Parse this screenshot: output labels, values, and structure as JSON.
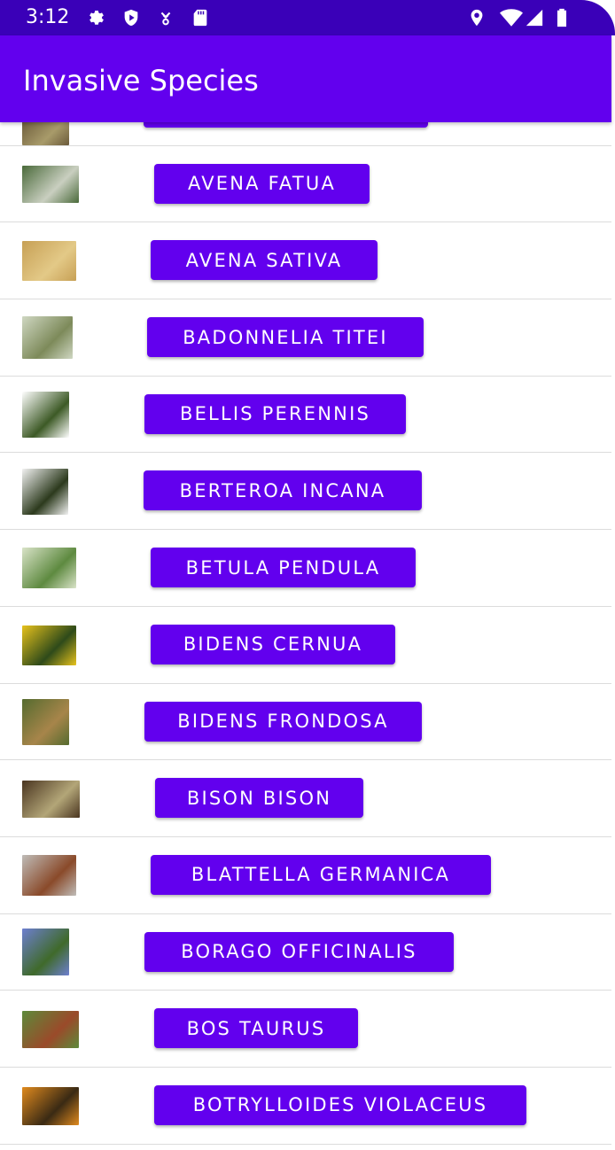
{
  "status_bar": {
    "time": "3:12",
    "left_icons": [
      "gear-icon",
      "shield-icon",
      "nfc-icon",
      "sd-card-icon"
    ],
    "right_icons": [
      "location-icon",
      "wifi-icon",
      "signal-icon",
      "battery-icon"
    ]
  },
  "app_bar": {
    "title": "Invasive Species"
  },
  "list": {
    "items": [
      {
        "label": "",
        "thumb_colors": [
          "#6b5a3a",
          "#a89b6a"
        ]
      },
      {
        "label": "AVENA FATUA",
        "thumb_colors": [
          "#4a6a3a",
          "#c9cfc0"
        ]
      },
      {
        "label": "AVENA SATIVA",
        "thumb_colors": [
          "#c7a055",
          "#e3c987"
        ]
      },
      {
        "label": "BADONNELIA TITEI",
        "thumb_colors": [
          "#cfd7c2",
          "#7d8a5a"
        ]
      },
      {
        "label": "BELLIS PERENNIS",
        "thumb_colors": [
          "#ffffff",
          "#3d5a26"
        ]
      },
      {
        "label": "BERTEROA INCANA",
        "thumb_colors": [
          "#f2f2f2",
          "#2c3a1d"
        ]
      },
      {
        "label": "BETULA PENDULA",
        "thumb_colors": [
          "#d9e3c8",
          "#5e8a40"
        ]
      },
      {
        "label": "BIDENS CERNUA",
        "thumb_colors": [
          "#e7c21c",
          "#2e4a1a"
        ]
      },
      {
        "label": "BIDENS FRONDOSA",
        "thumb_colors": [
          "#556b2f",
          "#a7854a"
        ]
      },
      {
        "label": "BISON BISON",
        "thumb_colors": [
          "#4a3520",
          "#b3a678"
        ]
      },
      {
        "label": "BLATTELLA GERMANICA",
        "thumb_colors": [
          "#bfbcb8",
          "#8a4a2a"
        ]
      },
      {
        "label": "BORAGO OFFICINALIS",
        "thumb_colors": [
          "#6d7fd0",
          "#3f6a2a"
        ]
      },
      {
        "label": "BOS TAURUS",
        "thumb_colors": [
          "#5d8a3a",
          "#9a4a2a"
        ]
      },
      {
        "label": "BOTRYLLOIDES VIOLACEUS",
        "thumb_colors": [
          "#e08a1e",
          "#3a2a14"
        ]
      }
    ]
  }
}
